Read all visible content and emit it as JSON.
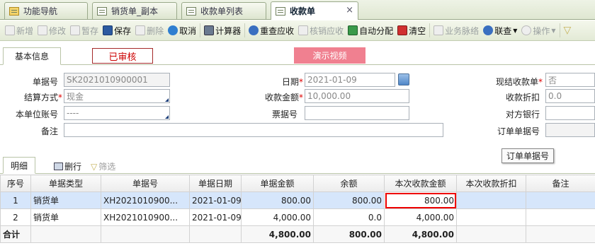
{
  "tabs": [
    {
      "label": "功能导航"
    },
    {
      "label": "销货单_副本"
    },
    {
      "label": "收款单列表"
    },
    {
      "label": "收款单"
    }
  ],
  "tab_close": "×",
  "toolbar": {
    "new": "新增",
    "edit": "修改",
    "draft": "暂存",
    "save": "保存",
    "delete": "删除",
    "cancel": "取消",
    "calculator": "计算器",
    "reselect": "重查应收",
    "verify": "核销应收",
    "auto_assign": "自动分配",
    "clear": "清空",
    "biz_flow": "业务脉络",
    "link": "联查",
    "ops": "操作"
  },
  "section_tab": "基本信息",
  "status_badge": "已审核",
  "demo_button": "演示视频",
  "form": {
    "doc_no_label": "单据号",
    "doc_no": "SK2021010900001",
    "date_label": "日期",
    "date": "2021-01-09",
    "cash_receipt_label": "现结收款单",
    "cash_receipt": "否",
    "settle_label": "结算方式",
    "settle": "现金",
    "amount_label": "收款金额",
    "amount": "10,000.00",
    "discount_label": "收款折扣",
    "discount": "0.0",
    "account_label": "本单位账号",
    "account": "----",
    "ticket_label": "票据号",
    "ticket": "",
    "bank_label": "对方银行",
    "bank": "",
    "remark_label": "备注",
    "remark": "",
    "order_no_label": "订单单据号",
    "order_no": ""
  },
  "tooltip": "订单单据号",
  "detail": {
    "tab": "明细",
    "delete_row": "删行",
    "filter": "筛选",
    "columns": [
      "序号",
      "单据类型",
      "单据号",
      "单据日期",
      "单据金额",
      "余额",
      "本次收款金额",
      "本次收款折扣",
      "备注"
    ],
    "rows": [
      {
        "seq": "1",
        "type": "销货单",
        "no": "XH2021010900...",
        "date": "2021-01-09",
        "amount": "800.00",
        "balance": "800.00",
        "recv": "800.00",
        "disc": "",
        "remark": ""
      },
      {
        "seq": "2",
        "type": "销货单",
        "no": "XH2021010900...",
        "date": "2021-01-09",
        "amount": "4,000.00",
        "balance": "0.0",
        "recv": "4,000.00",
        "disc": "",
        "remark": ""
      }
    ],
    "total": {
      "label": "合计",
      "amount": "4,800.00",
      "balance": "800.00",
      "recv": "4,800.00"
    }
  }
}
